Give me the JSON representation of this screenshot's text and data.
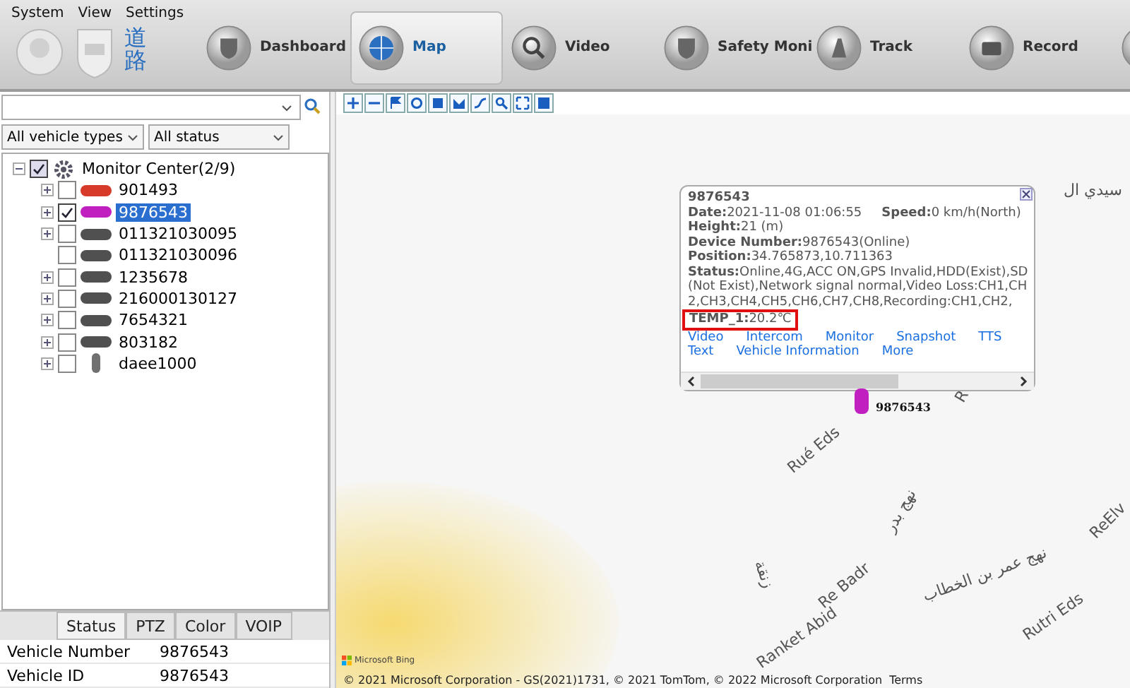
{
  "menu": [
    "System",
    "View",
    "Settings"
  ],
  "logo_text": "道路",
  "nav": [
    {
      "label": "Dashboard",
      "kind": "shield",
      "selected": false
    },
    {
      "label": "Map",
      "kind": "globe",
      "selected": true
    },
    {
      "label": "Video",
      "kind": "search",
      "selected": false
    },
    {
      "label": "Safety Moni",
      "kind": "shield",
      "selected": false
    },
    {
      "label": "Track",
      "kind": "road",
      "selected": false
    },
    {
      "label": "Record",
      "kind": "camera",
      "selected": false
    },
    {
      "kind": "blank",
      "selected": false
    }
  ],
  "filters": [
    {
      "value": "All vehicle types"
    },
    {
      "value": "All status"
    }
  ],
  "tree": {
    "label": "Monitor Center(2/9)",
    "checked": true,
    "expanded": true,
    "children": [
      {
        "label": "901493",
        "checked": false,
        "selected": false,
        "expandable": true,
        "color": "#d83a2a",
        "kind": "car"
      },
      {
        "label": "9876543",
        "checked": true,
        "selected": true,
        "expandable": true,
        "color": "#c020c0",
        "kind": "car"
      },
      {
        "label": "011321030095",
        "checked": false,
        "selected": false,
        "expandable": true,
        "color": "#505050",
        "kind": "car"
      },
      {
        "label": "011321030096",
        "checked": false,
        "selected": false,
        "expandable": false,
        "color": "#505050",
        "kind": "car"
      },
      {
        "label": "1235678",
        "checked": false,
        "selected": false,
        "expandable": true,
        "color": "#505050",
        "kind": "car"
      },
      {
        "label": "216000130127",
        "checked": false,
        "selected": false,
        "expandable": true,
        "color": "#505050",
        "kind": "car"
      },
      {
        "label": "7654321",
        "checked": false,
        "selected": false,
        "expandable": true,
        "color": "#505050",
        "kind": "car"
      },
      {
        "label": "803182",
        "checked": false,
        "selected": false,
        "expandable": true,
        "color": "#505050",
        "kind": "car"
      },
      {
        "label": "daee1000",
        "checked": false,
        "selected": false,
        "expandable": true,
        "color": "#707070",
        "kind": "person"
      }
    ]
  },
  "panel_tabs": [
    {
      "label": "Status",
      "selected": true
    },
    {
      "label": "PTZ",
      "selected": false
    },
    {
      "label": "Color",
      "selected": false
    },
    {
      "label": "VOIP",
      "selected": false
    }
  ],
  "info_rows": [
    {
      "label": "Vehicle Number",
      "value": "9876543"
    },
    {
      "label": "Vehicle ID",
      "value": "9876543"
    }
  ],
  "popup": {
    "title": "9876543",
    "lines": [
      "**Date:**2021-11-08 01:06:55",
      "**Height:**21 (m)",
      "**Device Number:**9876543(Online)",
      "**Position:**34.765873,10.711363",
      "**Status:**Online,4G,ACC ON,GPS Invalid,HDD(Exist),SD(Not Exist),Network signal normal,Video Loss:CH1,CH2,CH3,CH4,CH5,CH6,CH7,CH8,Recording:CH1,CH2,"
    ],
    "speed": "**Speed:**0 km/h(North)",
    "temp": "**TEMP_1:**20.2℃",
    "links": [
      [
        "Video",
        "Intercom",
        "Monitor",
        "Snapshot",
        "TTS"
      ],
      [
        "Text",
        "Vehicle Information",
        "More"
      ]
    ]
  },
  "marker": {
    "label": "9876543",
    "color": "#c020c0"
  },
  "map_labels": [
    "سيدي ال",
    "R",
    "Rué Eds",
    "نهج بدر",
    "Re Badr",
    "نهج عمر بن الخطاب",
    "ReElv",
    "Rutri Eds",
    "Ranket Abid",
    "زنقة"
  ],
  "bing": "Microsoft Bing",
  "copyright": "© 2021 Microsoft Corporation - GS(2021)1731, © 2021 TomTom, © 2022 Microsoft Corporation",
  "terms": "Terms"
}
